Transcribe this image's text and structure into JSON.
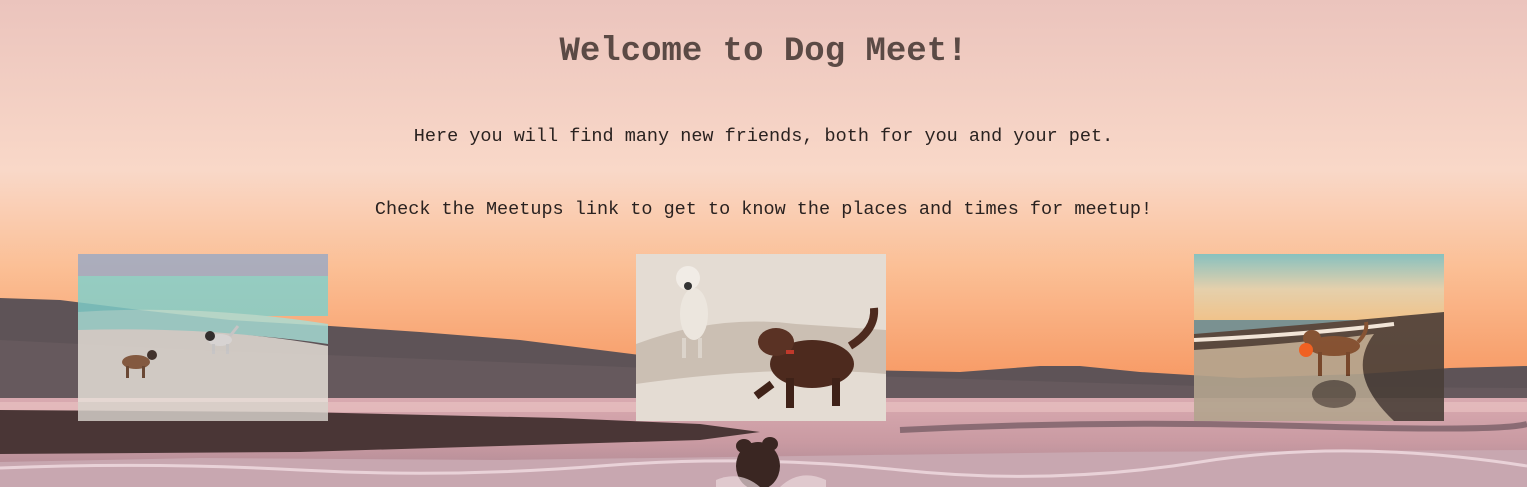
{
  "page": {
    "title": "Welcome to Dog Meet!",
    "intro_line_1": "Here you will find many new friends, both for you and your pet.",
    "intro_line_2": "Check the Meetups link to get to know the places and times for meetup!"
  },
  "colors": {
    "title": "#5b4a45",
    "body_text": "#2a2220",
    "sky_top": "#e9c3bc",
    "sky_mid": "#f6cfbb",
    "sky_horizon": "#f8a46e",
    "hills": "#5f5457",
    "sea": "#c49aa0"
  },
  "photos": [
    {
      "icon": "dogs-on-beach-photo"
    },
    {
      "icon": "dogs-playing-sand-photo"
    },
    {
      "icon": "dog-with-ball-photo"
    }
  ]
}
